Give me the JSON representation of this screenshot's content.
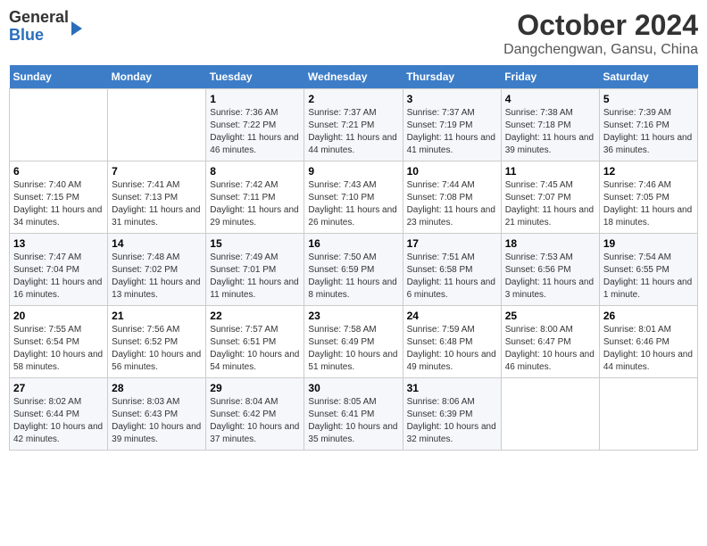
{
  "logo": {
    "line1": "General",
    "line2": "Blue"
  },
  "title": "October 2024",
  "subtitle": "Dangchengwan, Gansu, China",
  "days_of_week": [
    "Sunday",
    "Monday",
    "Tuesday",
    "Wednesday",
    "Thursday",
    "Friday",
    "Saturday"
  ],
  "weeks": [
    [
      {
        "day": "",
        "sunrise": "",
        "sunset": "",
        "daylight": ""
      },
      {
        "day": "",
        "sunrise": "",
        "sunset": "",
        "daylight": ""
      },
      {
        "day": "1",
        "sunrise": "Sunrise: 7:36 AM",
        "sunset": "Sunset: 7:22 PM",
        "daylight": "Daylight: 11 hours and 46 minutes."
      },
      {
        "day": "2",
        "sunrise": "Sunrise: 7:37 AM",
        "sunset": "Sunset: 7:21 PM",
        "daylight": "Daylight: 11 hours and 44 minutes."
      },
      {
        "day": "3",
        "sunrise": "Sunrise: 7:37 AM",
        "sunset": "Sunset: 7:19 PM",
        "daylight": "Daylight: 11 hours and 41 minutes."
      },
      {
        "day": "4",
        "sunrise": "Sunrise: 7:38 AM",
        "sunset": "Sunset: 7:18 PM",
        "daylight": "Daylight: 11 hours and 39 minutes."
      },
      {
        "day": "5",
        "sunrise": "Sunrise: 7:39 AM",
        "sunset": "Sunset: 7:16 PM",
        "daylight": "Daylight: 11 hours and 36 minutes."
      }
    ],
    [
      {
        "day": "6",
        "sunrise": "Sunrise: 7:40 AM",
        "sunset": "Sunset: 7:15 PM",
        "daylight": "Daylight: 11 hours and 34 minutes."
      },
      {
        "day": "7",
        "sunrise": "Sunrise: 7:41 AM",
        "sunset": "Sunset: 7:13 PM",
        "daylight": "Daylight: 11 hours and 31 minutes."
      },
      {
        "day": "8",
        "sunrise": "Sunrise: 7:42 AM",
        "sunset": "Sunset: 7:11 PM",
        "daylight": "Daylight: 11 hours and 29 minutes."
      },
      {
        "day": "9",
        "sunrise": "Sunrise: 7:43 AM",
        "sunset": "Sunset: 7:10 PM",
        "daylight": "Daylight: 11 hours and 26 minutes."
      },
      {
        "day": "10",
        "sunrise": "Sunrise: 7:44 AM",
        "sunset": "Sunset: 7:08 PM",
        "daylight": "Daylight: 11 hours and 23 minutes."
      },
      {
        "day": "11",
        "sunrise": "Sunrise: 7:45 AM",
        "sunset": "Sunset: 7:07 PM",
        "daylight": "Daylight: 11 hours and 21 minutes."
      },
      {
        "day": "12",
        "sunrise": "Sunrise: 7:46 AM",
        "sunset": "Sunset: 7:05 PM",
        "daylight": "Daylight: 11 hours and 18 minutes."
      }
    ],
    [
      {
        "day": "13",
        "sunrise": "Sunrise: 7:47 AM",
        "sunset": "Sunset: 7:04 PM",
        "daylight": "Daylight: 11 hours and 16 minutes."
      },
      {
        "day": "14",
        "sunrise": "Sunrise: 7:48 AM",
        "sunset": "Sunset: 7:02 PM",
        "daylight": "Daylight: 11 hours and 13 minutes."
      },
      {
        "day": "15",
        "sunrise": "Sunrise: 7:49 AM",
        "sunset": "Sunset: 7:01 PM",
        "daylight": "Daylight: 11 hours and 11 minutes."
      },
      {
        "day": "16",
        "sunrise": "Sunrise: 7:50 AM",
        "sunset": "Sunset: 6:59 PM",
        "daylight": "Daylight: 11 hours and 8 minutes."
      },
      {
        "day": "17",
        "sunrise": "Sunrise: 7:51 AM",
        "sunset": "Sunset: 6:58 PM",
        "daylight": "Daylight: 11 hours and 6 minutes."
      },
      {
        "day": "18",
        "sunrise": "Sunrise: 7:53 AM",
        "sunset": "Sunset: 6:56 PM",
        "daylight": "Daylight: 11 hours and 3 minutes."
      },
      {
        "day": "19",
        "sunrise": "Sunrise: 7:54 AM",
        "sunset": "Sunset: 6:55 PM",
        "daylight": "Daylight: 11 hours and 1 minute."
      }
    ],
    [
      {
        "day": "20",
        "sunrise": "Sunrise: 7:55 AM",
        "sunset": "Sunset: 6:54 PM",
        "daylight": "Daylight: 10 hours and 58 minutes."
      },
      {
        "day": "21",
        "sunrise": "Sunrise: 7:56 AM",
        "sunset": "Sunset: 6:52 PM",
        "daylight": "Daylight: 10 hours and 56 minutes."
      },
      {
        "day": "22",
        "sunrise": "Sunrise: 7:57 AM",
        "sunset": "Sunset: 6:51 PM",
        "daylight": "Daylight: 10 hours and 54 minutes."
      },
      {
        "day": "23",
        "sunrise": "Sunrise: 7:58 AM",
        "sunset": "Sunset: 6:49 PM",
        "daylight": "Daylight: 10 hours and 51 minutes."
      },
      {
        "day": "24",
        "sunrise": "Sunrise: 7:59 AM",
        "sunset": "Sunset: 6:48 PM",
        "daylight": "Daylight: 10 hours and 49 minutes."
      },
      {
        "day": "25",
        "sunrise": "Sunrise: 8:00 AM",
        "sunset": "Sunset: 6:47 PM",
        "daylight": "Daylight: 10 hours and 46 minutes."
      },
      {
        "day": "26",
        "sunrise": "Sunrise: 8:01 AM",
        "sunset": "Sunset: 6:46 PM",
        "daylight": "Daylight: 10 hours and 44 minutes."
      }
    ],
    [
      {
        "day": "27",
        "sunrise": "Sunrise: 8:02 AM",
        "sunset": "Sunset: 6:44 PM",
        "daylight": "Daylight: 10 hours and 42 minutes."
      },
      {
        "day": "28",
        "sunrise": "Sunrise: 8:03 AM",
        "sunset": "Sunset: 6:43 PM",
        "daylight": "Daylight: 10 hours and 39 minutes."
      },
      {
        "day": "29",
        "sunrise": "Sunrise: 8:04 AM",
        "sunset": "Sunset: 6:42 PM",
        "daylight": "Daylight: 10 hours and 37 minutes."
      },
      {
        "day": "30",
        "sunrise": "Sunrise: 8:05 AM",
        "sunset": "Sunset: 6:41 PM",
        "daylight": "Daylight: 10 hours and 35 minutes."
      },
      {
        "day": "31",
        "sunrise": "Sunrise: 8:06 AM",
        "sunset": "Sunset: 6:39 PM",
        "daylight": "Daylight: 10 hours and 32 minutes."
      },
      {
        "day": "",
        "sunrise": "",
        "sunset": "",
        "daylight": ""
      },
      {
        "day": "",
        "sunrise": "",
        "sunset": "",
        "daylight": ""
      }
    ]
  ]
}
